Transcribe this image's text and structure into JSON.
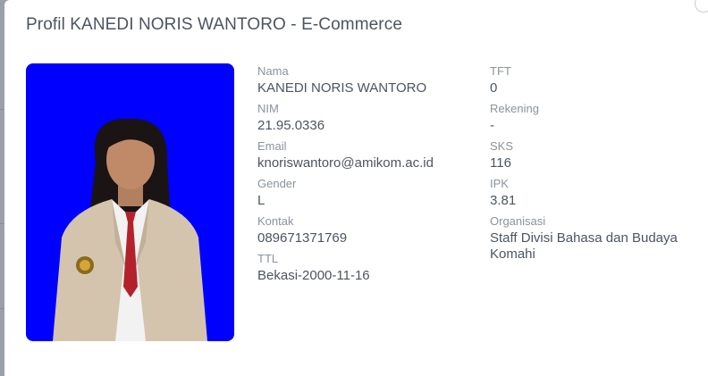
{
  "modal": {
    "title": "Profil KANEDI NORIS WANTORO - E-Commerce"
  },
  "profile": {
    "photo_bg_color": "#0000ff",
    "fields_left": [
      {
        "label": "Nama",
        "value": "KANEDI NORIS WANTORO"
      },
      {
        "label": "NIM",
        "value": "21.95.0336"
      },
      {
        "label": "Email",
        "value": "knoriswantoro@amikom.ac.id"
      },
      {
        "label": "Gender",
        "value": "L"
      },
      {
        "label": "Kontak",
        "value": "089671371769"
      },
      {
        "label": "TTL",
        "value": "Bekasi-2000-11-16"
      }
    ],
    "fields_right": [
      {
        "label": "TFT",
        "value": "0"
      },
      {
        "label": "Rekening",
        "value": "-"
      },
      {
        "label": "SKS",
        "value": "116"
      },
      {
        "label": "IPK",
        "value": "3.81"
      },
      {
        "label": "Organisasi",
        "value": "Staff Divisi Bahasa dan Budaya Komahi"
      }
    ]
  }
}
